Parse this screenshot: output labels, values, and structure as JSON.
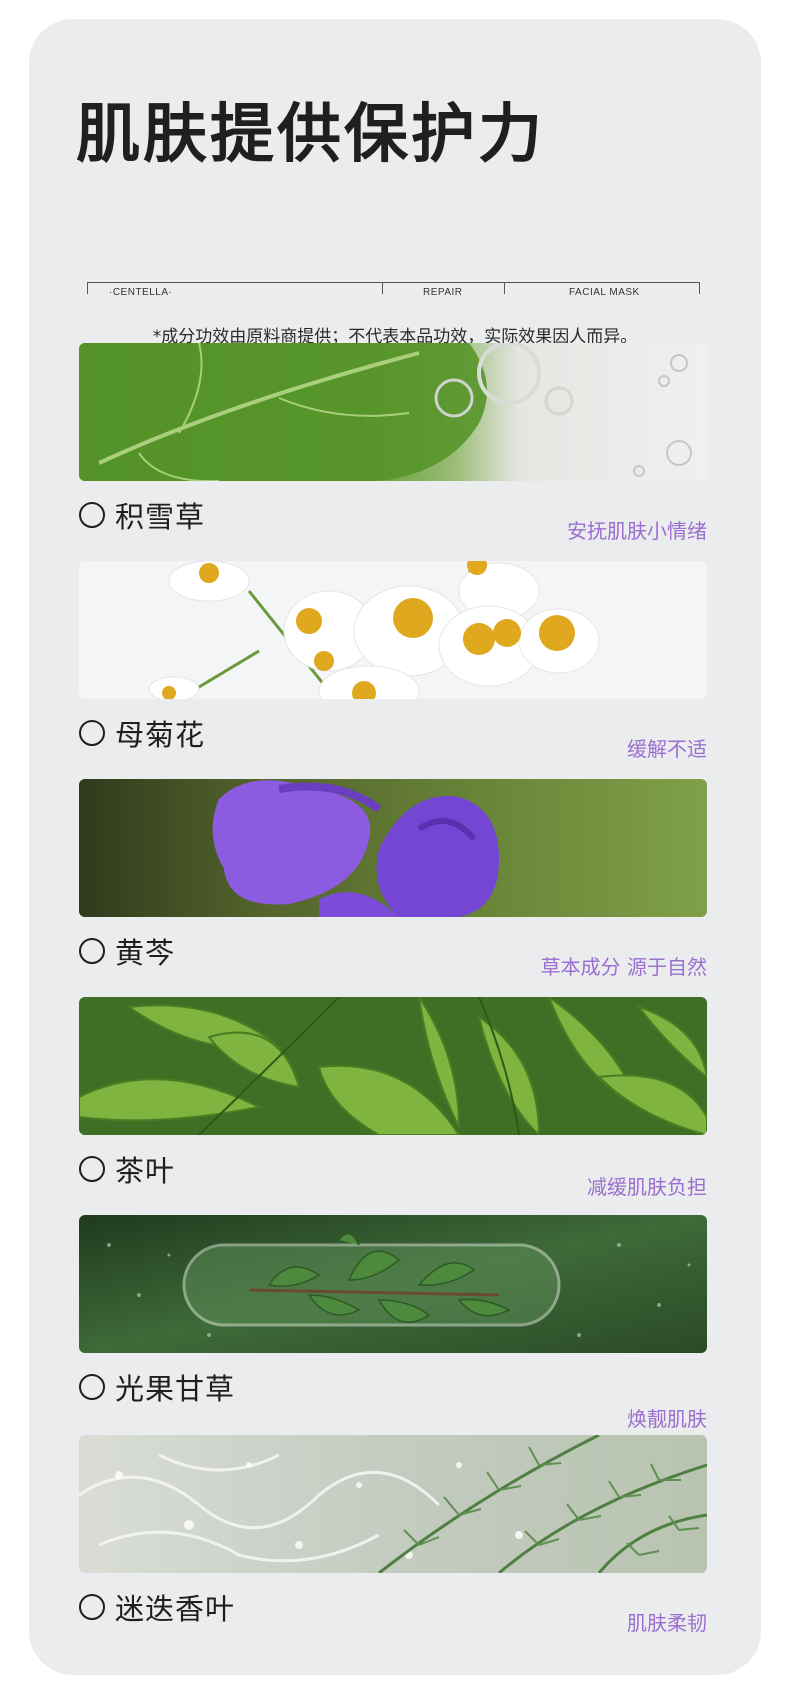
{
  "title": "肌肤提供保护力",
  "ruler": {
    "labels": [
      "·CENTELLA·",
      "REPAIR",
      "FACIAL MASK"
    ]
  },
  "disclaimer": "*成分功效由原料商提供；不代表本品功效，实际效果因人而异。",
  "colors": {
    "card_background": "#ebecee",
    "title_text": "#1f1f1f",
    "tag_text": "#9a6fd0"
  },
  "ingredients": [
    {
      "name": "积雪草",
      "tag": "安抚肌肤小情绪",
      "image": "centella-leaf-water-drops"
    },
    {
      "name": "母菊花",
      "tag": "缓解不适",
      "image": "chamomile-flowers"
    },
    {
      "name": "黄芩",
      "tag": "草本成分 源于自然",
      "image": "purple-skullcap-flower"
    },
    {
      "name": "茶叶",
      "tag": "减缓肌肤负担",
      "image": "green-tea-leaves"
    },
    {
      "name": "光果甘草",
      "tag": "焕靓肌肤",
      "image": "licorice-sprig-glass-dish"
    },
    {
      "name": "迷迭香叶",
      "tag": "肌肤柔韧",
      "image": "rosemary-water-splash"
    }
  ]
}
